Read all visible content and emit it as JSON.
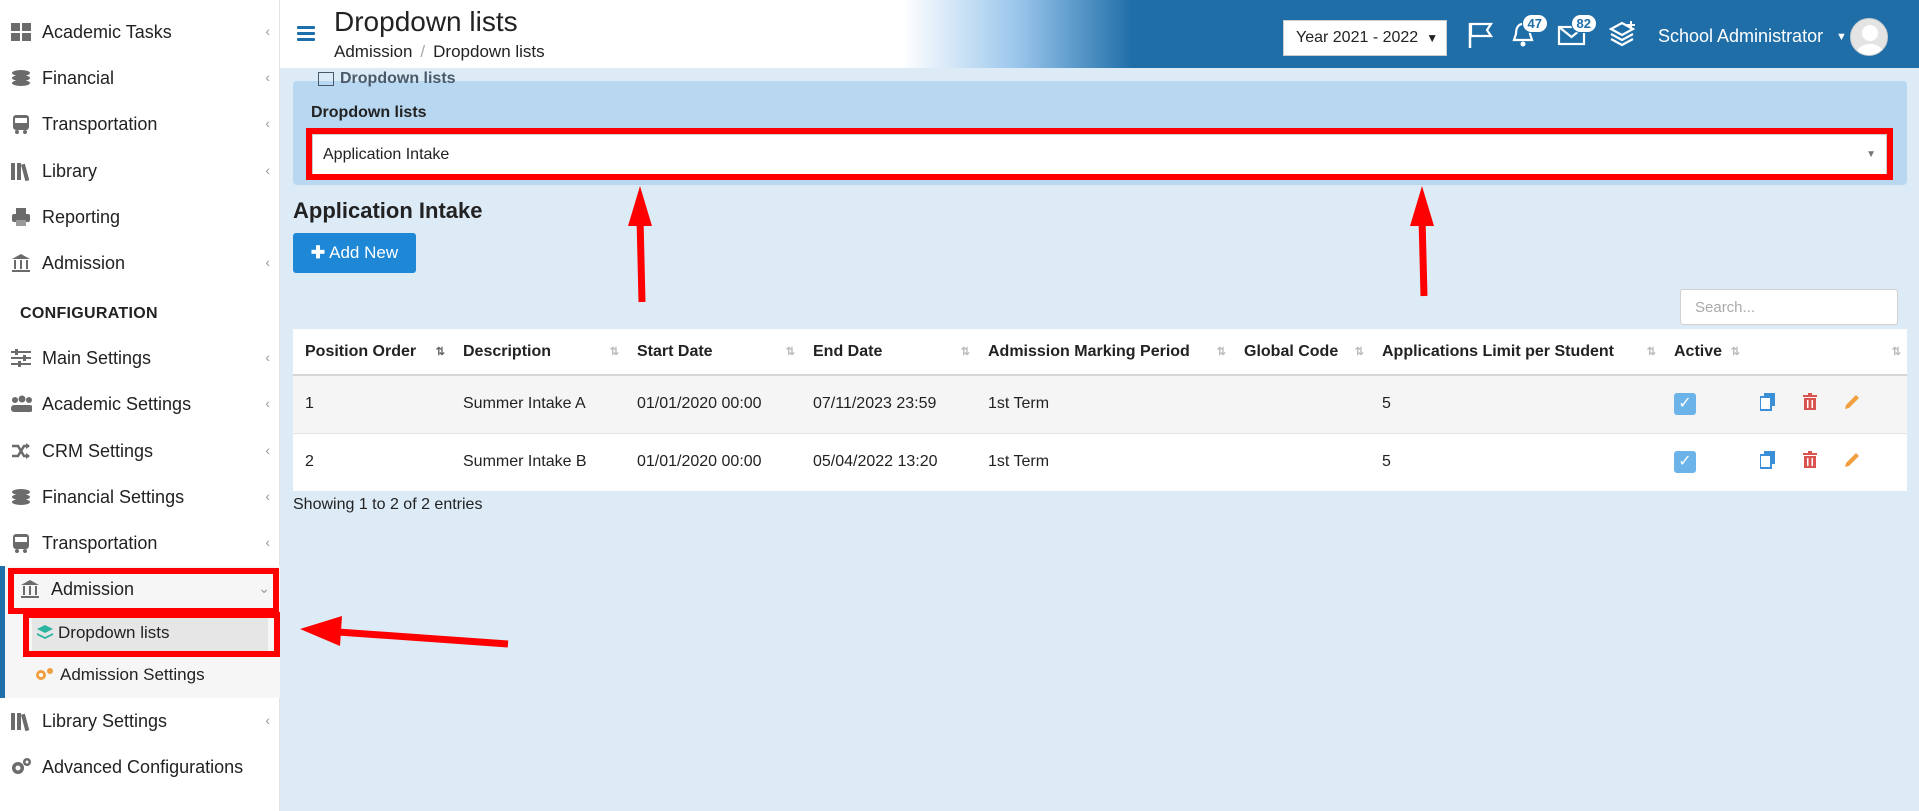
{
  "sidebar": {
    "items": [
      {
        "label": "Academic Tasks",
        "icon": "grid-icon"
      },
      {
        "label": "Financial",
        "icon": "coins-icon"
      },
      {
        "label": "Transportation",
        "icon": "bus-icon"
      },
      {
        "label": "Library",
        "icon": "books-icon"
      },
      {
        "label": "Reporting",
        "icon": "printer-icon"
      },
      {
        "label": "Admission",
        "icon": "bank-icon"
      }
    ],
    "config_heading": "CONFIGURATION",
    "config_items": [
      {
        "label": "Main Settings",
        "icon": "sliders-icon"
      },
      {
        "label": "Academic Settings",
        "icon": "users-icon"
      },
      {
        "label": "CRM Settings",
        "icon": "shuffle-icon"
      },
      {
        "label": "Financial Settings",
        "icon": "coins-icon"
      },
      {
        "label": "Transportation",
        "icon": "bus-icon"
      },
      {
        "label": "Admission",
        "icon": "bank-icon"
      }
    ],
    "admission_sub": [
      {
        "label": "Dropdown lists",
        "icon": "layers-icon"
      },
      {
        "label": "Admission Settings",
        "icon": "gears-icon"
      }
    ],
    "bottom_items": [
      {
        "label": "Library Settings",
        "icon": "books-icon"
      },
      {
        "label": "Advanced Configurations",
        "icon": "gears-icon"
      }
    ]
  },
  "header": {
    "title": "Dropdown lists",
    "breadcrumb": [
      "Admission",
      "Dropdown lists"
    ],
    "year": "Year 2021 - 2022",
    "notifications_count": "47",
    "messages_count": "82",
    "user": "School Administrator"
  },
  "panel": {
    "heading": "Dropdown lists",
    "field_label": "Dropdown lists",
    "selected": "Application Intake"
  },
  "main": {
    "section_title": "Application Intake",
    "add_button": "Add New",
    "search_placeholder": "Search...",
    "columns": [
      "Position Order",
      "Description",
      "Start Date",
      "End Date",
      "Admission Marking Period",
      "Global Code",
      "Applications Limit per Student",
      "Active",
      ""
    ],
    "rows": [
      {
        "position": "1",
        "description": "Summer Intake A",
        "start": "01/01/2020 00:00",
        "end": "07/11/2023 23:59",
        "period": "1st Term",
        "code": "",
        "limit": "5",
        "active": true
      },
      {
        "position": "2",
        "description": "Summer Intake B",
        "start": "01/01/2020 00:00",
        "end": "05/04/2022 13:20",
        "period": "1st Term",
        "code": "",
        "limit": "5",
        "active": true
      }
    ],
    "info": "Showing 1 to 2 of 2 entries"
  },
  "colors": {
    "accent": "#1f6ea8",
    "button": "#1e88d6",
    "annotation": "#ff0000",
    "background": "#ddebf7"
  }
}
